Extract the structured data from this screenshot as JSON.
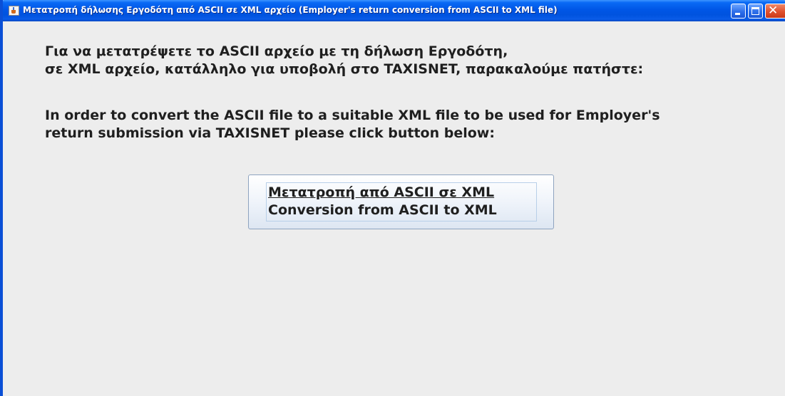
{
  "window": {
    "title": "Μετατροπή δήλωσης Εργοδότη από ASCII σε XML αρχείο (Employer's return conversion from ASCII to XML file)",
    "icon": "java-cup-icon",
    "controls": {
      "minimize_icon": "minimize-icon",
      "maximize_icon": "maximize-icon",
      "close_icon": "close-icon",
      "close_glyph": "✕"
    }
  },
  "message": {
    "greek_line1": "Για να μετατρέψετε το ASCII αρχείο με τη δήλωση Εργοδότη,",
    "greek_line2": "σε XML αρχείο, κατάλληλο για υποβολή στο TAXISNET, παρακαλούμε πατήστε:",
    "english_line1": "In order to convert the ASCII file to a suitable XML file to be used for Employer's",
    "english_line2": "return submission via TAXISNET please click button below:"
  },
  "convert_button": {
    "label_greek": "Μετατροπή από ASCII σε XML",
    "label_english": "Conversion from ASCII to XML"
  },
  "colors": {
    "titlebar": "#0053df",
    "window_border": "#0a4fd6",
    "background": "#ededed",
    "text": "#1f1f1f",
    "close_button": "#e0502d"
  }
}
